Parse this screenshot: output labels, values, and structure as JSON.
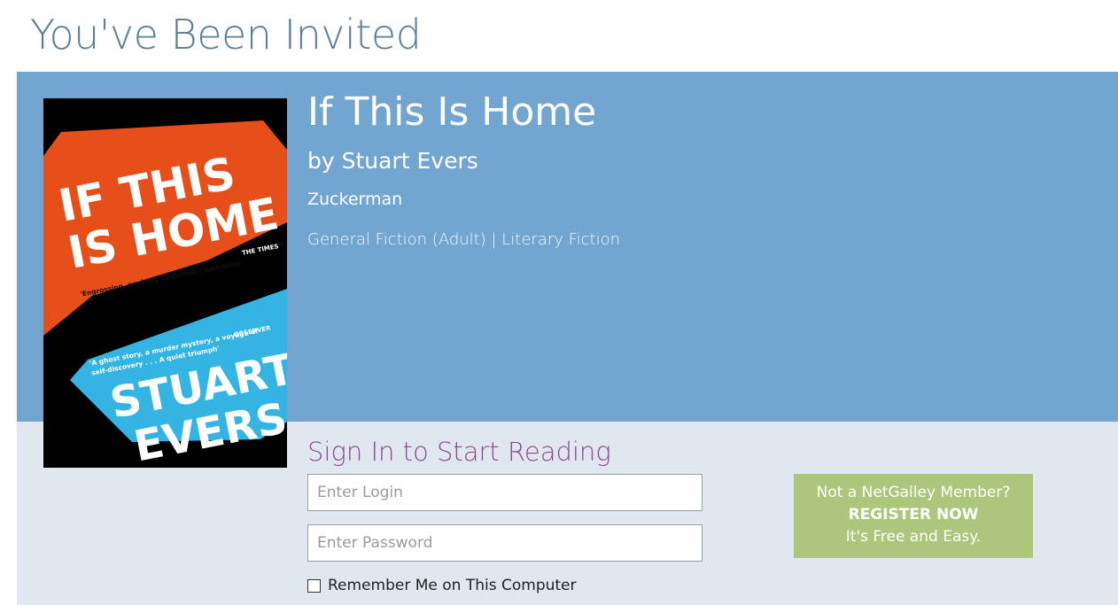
{
  "page": {
    "title": "You've Been Invited"
  },
  "book": {
    "title": "If This Is Home",
    "author": "by Stuart Evers",
    "publisher": "Zuckerman",
    "categories": "General Fiction (Adult) | Literary Fiction",
    "cover": {
      "title_line1": "IF THIS",
      "title_line2": "IS HOME",
      "quote1": "'Engrossing, enviably beautiful, captivating'",
      "quote1_source": "THE TIMES",
      "quote2_line1": "'A ghost story, a murder mystery, a voyage of",
      "quote2_line2": "self-discovery . . . A quiet triumph'",
      "quote2_source": "OBSERVER",
      "author_line1": "STUART",
      "author_line2": "EVERS",
      "colors": {
        "orange": "#e64f1a",
        "blue": "#33b4e3",
        "background": "#000000"
      }
    }
  },
  "signin": {
    "heading": "Sign In to Start Reading",
    "login_placeholder": "Enter Login",
    "password_placeholder": "Enter Password",
    "remember_label": "Remember Me on This Computer"
  },
  "register": {
    "line1": "Not a NetGalley Member?",
    "line2": "REGISTER NOW",
    "line3": "It's Free and Easy."
  },
  "colors": {
    "title": "#5c7f95",
    "banner": "#72a6d1",
    "panel": "#e1e7ef",
    "signin_heading": "#8a4a95",
    "register_bg": "#acc77c"
  }
}
